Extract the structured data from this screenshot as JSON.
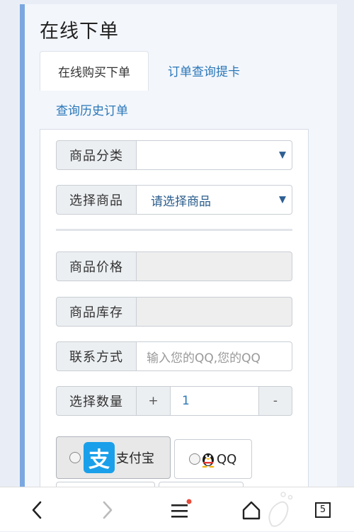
{
  "page": {
    "title": "在线下单"
  },
  "tabs": {
    "active": "在线购买下单",
    "query_card": "订单查询提卡",
    "history": "查询历史订单"
  },
  "form": {
    "category_label": "商品分类",
    "category_value": "",
    "product_label": "选择商品",
    "product_value": "请选择商品",
    "price_label": "商品价格",
    "stock_label": "商品库存",
    "contact_label": "联系方式",
    "contact_placeholder": "输入您的QQ,您的QQ",
    "quantity_label": "选择数量",
    "qty_plus": "+",
    "qty_value": "1",
    "qty_minus": "-"
  },
  "payment": {
    "alipay_label": "支付宝",
    "qq_label": "QQ",
    "alipay_glyph": "支"
  },
  "browser": {
    "tab_count": "5"
  },
  "colors": {
    "accent": "#2a77b8",
    "panel_border": "#7ba7e0",
    "alipay": "#1aa0ea",
    "notify": "#e74c3c"
  }
}
